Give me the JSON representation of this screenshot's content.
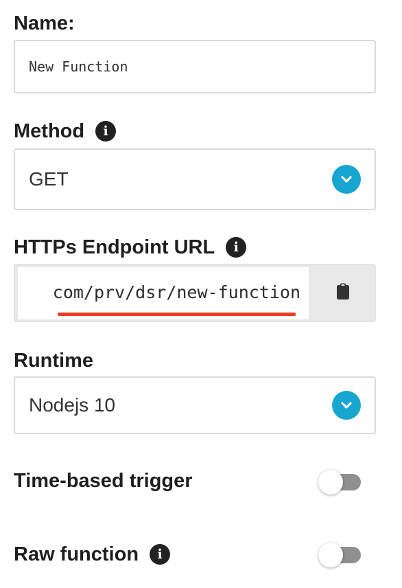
{
  "name": {
    "label": "Name:",
    "value": "New Function"
  },
  "method": {
    "label": "Method",
    "selected": "GET",
    "info_icon": "info-icon"
  },
  "endpoint": {
    "label": "HTTPs Endpoint URL",
    "url_visible": "com/prv/dsr/new-function",
    "info_icon": "info-icon",
    "copy_icon": "clipboard-icon",
    "underline_color": "#ee3b24"
  },
  "runtime": {
    "label": "Runtime",
    "selected": "Nodejs 10"
  },
  "time_trigger": {
    "label": "Time-based trigger",
    "enabled": false
  },
  "raw_function": {
    "label": "Raw function",
    "enabled": false,
    "info_icon": "info-icon"
  },
  "colors": {
    "accent": "#17a6cf",
    "text": "#1f1f1f",
    "border": "#d9d9d9",
    "toggle_off": "#909090"
  }
}
